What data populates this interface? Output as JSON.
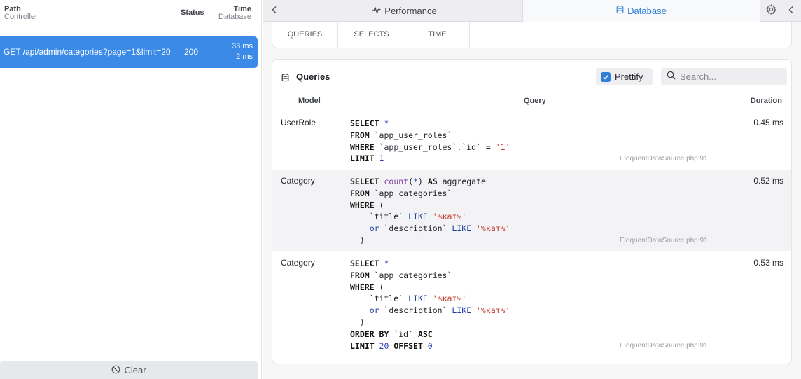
{
  "left_panel": {
    "headers": {
      "path": "Path",
      "controller": "Controller",
      "status": "Status",
      "time": "Time",
      "database": "Database"
    },
    "requests": [
      {
        "path": "GET /api/admin/categories?page=1&limit=20",
        "status": "200",
        "time": "33 ms",
        "db_time": "2 ms"
      }
    ],
    "clear_label": "Clear"
  },
  "tabs": {
    "performance_label": "Performance",
    "database_label": "Database",
    "active": "Database"
  },
  "stats": [
    {
      "label": "QUERIES"
    },
    {
      "label": "SELECTS"
    },
    {
      "label": "TIME"
    }
  ],
  "queries_panel": {
    "title": "Queries",
    "prettify_label": "Prettify",
    "prettify_checked": true,
    "search_placeholder": "Search...",
    "columns": {
      "model": "Model",
      "query": "Query",
      "duration": "Duration"
    },
    "rows": [
      {
        "model": "UserRole",
        "duration": "0.45 ms",
        "source": "EloquentDataSource.php:91",
        "sql_lines": [
          [
            [
              "kw",
              "SELECT "
            ],
            [
              "num",
              "*"
            ]
          ],
          [
            [
              "kw",
              "FROM "
            ],
            [
              "t",
              "`app_user_roles`"
            ]
          ],
          [
            [
              "kw",
              "WHERE "
            ],
            [
              "t",
              "`app_user_roles`.`id` = "
            ],
            [
              "str",
              "'1'"
            ]
          ],
          [
            [
              "kw",
              "LIMIT "
            ],
            [
              "num",
              "1"
            ]
          ]
        ]
      },
      {
        "model": "Category",
        "duration": "0.52 ms",
        "source": "EloquentDataSource.php:91",
        "sql_lines": [
          [
            [
              "kw",
              "SELECT "
            ],
            [
              "fn",
              "count"
            ],
            [
              "t",
              "("
            ],
            [
              "num",
              "*"
            ],
            [
              "t",
              ") "
            ],
            [
              "kw",
              "AS "
            ],
            [
              "t",
              "aggregate"
            ]
          ],
          [
            [
              "kw",
              "FROM "
            ],
            [
              "t",
              "`app_categories`"
            ]
          ],
          [
            [
              "kw",
              "WHERE "
            ],
            [
              "t",
              "("
            ]
          ],
          [
            [
              "t",
              "    `title` "
            ],
            [
              "kw2",
              "LIKE "
            ],
            [
              "str",
              "'%кат%'"
            ]
          ],
          [
            [
              "t",
              "    "
            ],
            [
              "kw2",
              "or "
            ],
            [
              "t",
              "`description` "
            ],
            [
              "kw2",
              "LIKE "
            ],
            [
              "str",
              "'%кат%'"
            ]
          ],
          [
            [
              "t",
              "  )"
            ]
          ]
        ]
      },
      {
        "model": "Category",
        "duration": "0.53 ms",
        "source": "EloquentDataSource.php:91",
        "sql_lines": [
          [
            [
              "kw",
              "SELECT "
            ],
            [
              "num",
              "*"
            ]
          ],
          [
            [
              "kw",
              "FROM "
            ],
            [
              "t",
              "`app_categories`"
            ]
          ],
          [
            [
              "kw",
              "WHERE "
            ],
            [
              "t",
              "("
            ]
          ],
          [
            [
              "t",
              "    `title` "
            ],
            [
              "kw2",
              "LIKE "
            ],
            [
              "str",
              "'%кат%'"
            ]
          ],
          [
            [
              "t",
              "    "
            ],
            [
              "kw2",
              "or "
            ],
            [
              "t",
              "`description` "
            ],
            [
              "kw2",
              "LIKE "
            ],
            [
              "str",
              "'%кат%'"
            ]
          ],
          [
            [
              "t",
              "  )"
            ]
          ],
          [
            [
              "kw",
              "ORDER BY "
            ],
            [
              "t",
              "`id` "
            ],
            [
              "kw",
              "ASC"
            ]
          ],
          [
            [
              "kw",
              "LIMIT "
            ],
            [
              "num",
              "20 "
            ],
            [
              "kw",
              "OFFSET "
            ],
            [
              "num",
              "0"
            ]
          ]
        ]
      }
    ]
  }
}
